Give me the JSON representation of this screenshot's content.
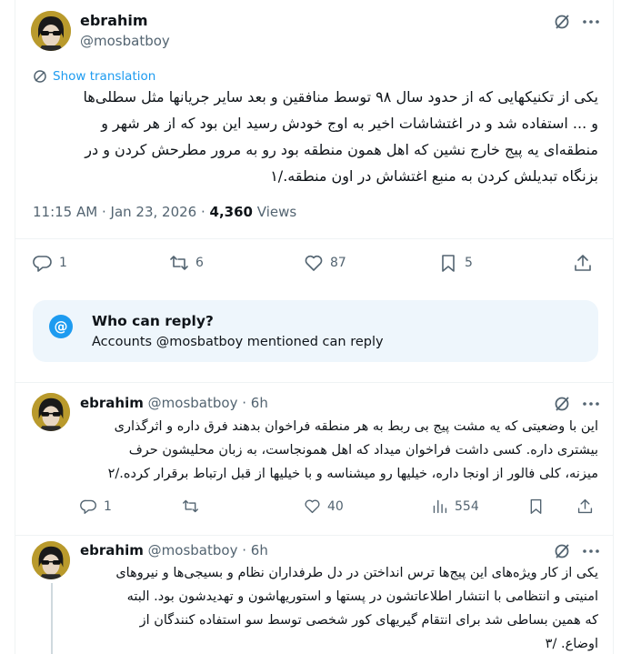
{
  "main_tweet": {
    "display_name": "ebrahim",
    "handle": "@mosbatboy",
    "show_translation": "Show translation",
    "text_lines": [
      "یکی از تکنیکهایی که از حدود سال ۹۸ توسط منافقین و بعد سایر جریانها مثل سطلی‌ها",
      "و ... استفاده شد و در اغتشاشات اخیر به اوج خودش رسید این بود که از هر شهر و",
      "منطقه‌ای یه پیج خارج نشین که اهل همون منطقه بود رو به مرور مطرحش کردن و در",
      "بزنگاه تبدیلش کردن به منبع اغتشاش در اون منطقه./۱"
    ],
    "time": "11:15 AM",
    "date": "Jan 23, 2026",
    "views_count": "4,360",
    "views_label": "Views",
    "stats": {
      "replies": "1",
      "reposts": "6",
      "likes": "87",
      "bookmarks": "5"
    }
  },
  "who_can_reply": {
    "title": "Who can reply?",
    "subtitle": "Accounts @mosbatboy mentioned can reply",
    "icon": "@"
  },
  "replies": [
    {
      "display_name": "ebrahim",
      "handle": "@mosbatboy",
      "age": "6h",
      "text_lines": [
        "این با وضعیتی که یه مشت پیج بی ربط به هر منطقه فراخوان بدهند فرق داره و اثرگذاری",
        "بیشتری داره. کسی داشت فراخوان میداد که اهل همونجاست، به زبان محلیشون حرف",
        "میزنه، کلی فالور از اونجا داره، خیلیها رو میشناسه و با خیلیها از قبل ارتباط برقرار کرده./۲"
      ],
      "stats": {
        "replies": "1",
        "likes": "40",
        "views": "554"
      }
    },
    {
      "display_name": "ebrahim",
      "handle": "@mosbatboy",
      "age": "6h",
      "text_lines": [
        "یکی از کار ویژه‌های این پیج‌ها ترس انداختن در دل طرفداران نظام و بسیجی‌ها و نیروهای",
        "امنیتی و انتظامی با انتشار اطلاعاتشون در پستها و استوریهاشون و تهدیدشون بود. البته",
        "که همین بساطی شد برای انتقام گیریهای کور شخصی توسط سو استفاده کنندگان از",
        "اوضاع. /۳"
      ]
    }
  ],
  "colors": {
    "accent": "#1d9bf0",
    "muted": "#536471",
    "text": "#0f1419"
  }
}
